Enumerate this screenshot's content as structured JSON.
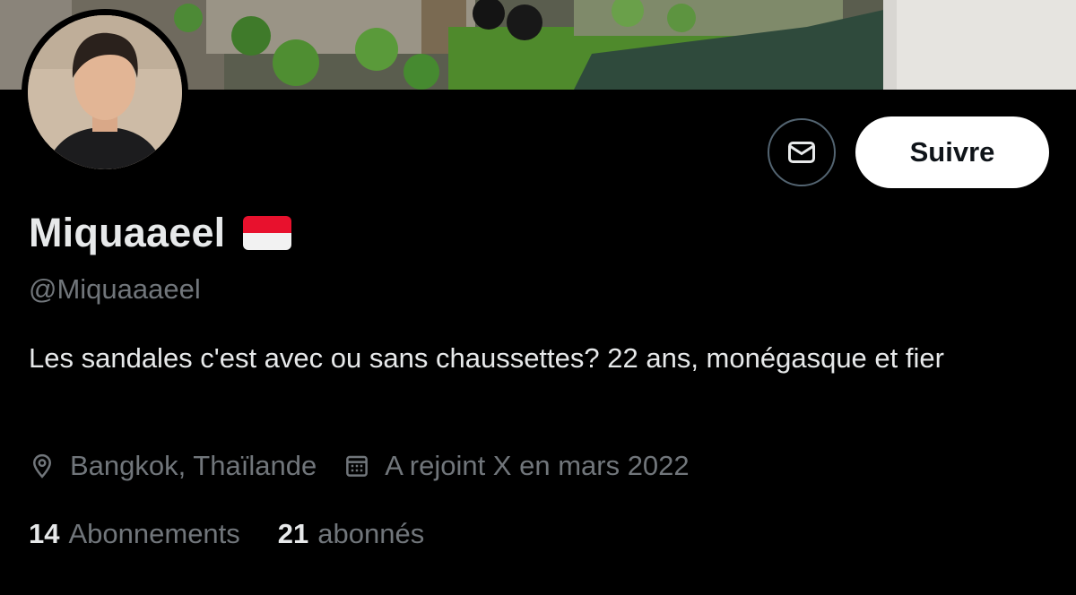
{
  "profile": {
    "display_name": "Miquaaeel",
    "handle": "@Miquaaaeel",
    "bio": "Les sandales c'est avec ou sans chaussettes? 22 ans, monégasque et fier",
    "location": "Bangkok, Thaïlande",
    "joined": "A rejoint X en mars 2022",
    "following_count": "14",
    "following_label": "Abonnements",
    "followers_count": "21",
    "followers_label": "abonnés"
  },
  "actions": {
    "follow_label": "Suivre",
    "message_icon": "mail-icon"
  },
  "icons": {
    "location": "location-pin-icon",
    "calendar": "calendar-icon",
    "flag": "monaco-flag"
  },
  "colors": {
    "background": "#000000",
    "primary_text": "#e7e9ea",
    "secondary_text": "#71767b",
    "button_bg": "#ffffff",
    "button_text": "#0f1419"
  }
}
